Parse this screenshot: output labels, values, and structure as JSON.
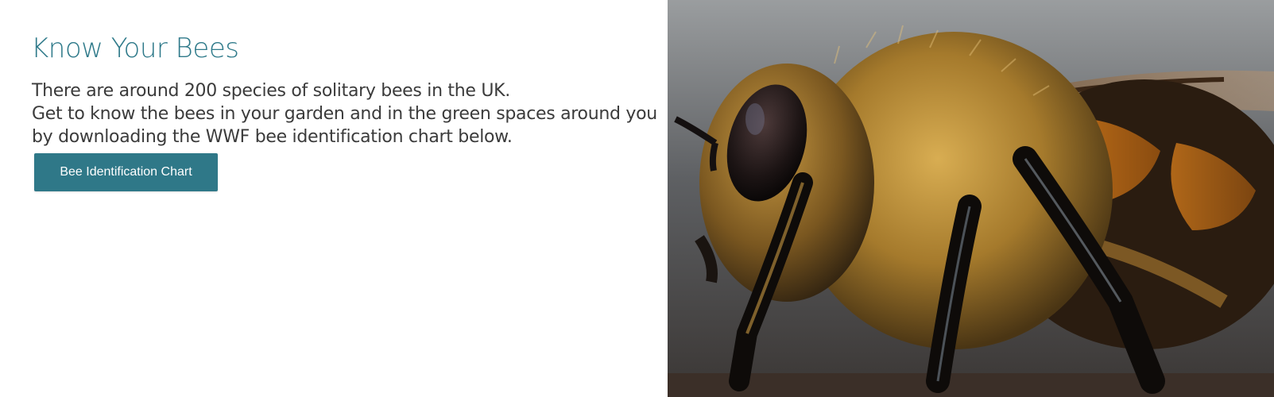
{
  "section": {
    "title": "Know Your Bees",
    "intro_line_1": "There are around 200 species of solitary bees in the UK.",
    "intro_line_2": "Get to know the bees in your garden and in the green spaces around you by downloading the WWF bee identification chart below.",
    "button_label": "Bee Identification Chart"
  },
  "colors": {
    "title": "#2f7a8a",
    "button_background": "#2f7888",
    "button_text": "#ffffff",
    "body_text": "#3b3b3b"
  },
  "image": {
    "subject": "close-up photo of a honey bee"
  }
}
